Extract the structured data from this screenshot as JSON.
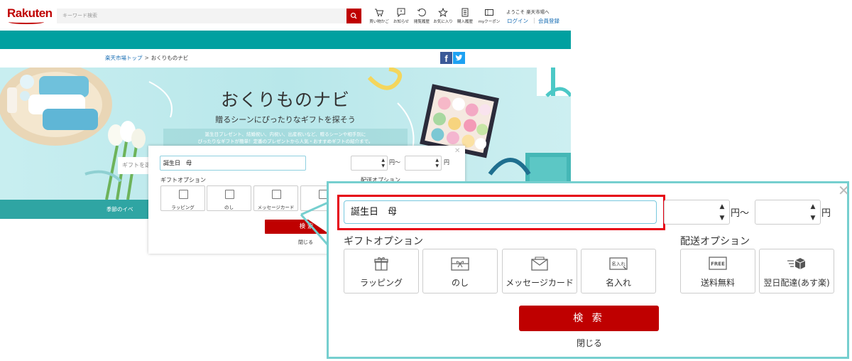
{
  "header": {
    "logo": "Rakuten",
    "search_placeholder": "キーワード検索",
    "icons": [
      {
        "label": "買い物かご",
        "icon": "cart-icon"
      },
      {
        "label": "お知らせ",
        "icon": "bell-icon"
      },
      {
        "label": "閲覧履歴",
        "icon": "history-icon"
      },
      {
        "label": "お気に入り",
        "icon": "star-icon"
      },
      {
        "label": "購入履歴",
        "icon": "receipt-icon"
      },
      {
        "label": "myクーポン",
        "icon": "coupon-icon"
      }
    ],
    "welcome": "ようこそ 楽天市場へ",
    "login": "ログイン",
    "separator": "|",
    "register": "会員登録"
  },
  "breadcrumb": {
    "home": "楽天市場トップ",
    "separator": ">",
    "current": "おくりものナビ"
  },
  "hero": {
    "title": "おくりものナビ",
    "subtitle": "贈るシーンにぴったりなギフトを探そう",
    "description_line1": "誕生日プレゼント、結婚祝い、内祝い、出産祝いなど、贈るシーンや相手別に",
    "description_line2": "ぴったりなギフトが簡単！定番のプレゼントから人気・おすすめギフトの紹介まで。",
    "search_placeholder": "ギフトを選"
  },
  "nav": {
    "season_label": "季節のイベ"
  },
  "popup": {
    "keyword": "誕生日　母",
    "yen_tilde": "円〜",
    "yen": "円",
    "gift_options_label": "ギフトオプション",
    "shipping_options_label": "配送オプション",
    "gift_options": [
      {
        "label": "ラッピング",
        "icon": "gift-box-icon"
      },
      {
        "label": "のし",
        "icon": "noshi-icon"
      },
      {
        "label": "メッセージカード",
        "icon": "envelope-icon"
      },
      {
        "label": "名入れ",
        "icon": "name-engrave-icon",
        "icon_text": "名入れ"
      }
    ],
    "shipping_options": [
      {
        "label": "送料無料",
        "icon": "free-shipping-icon",
        "icon_text": "FREE"
      },
      {
        "label": "翌日配達(あす楽)",
        "icon": "next-day-delivery-icon"
      }
    ],
    "search_button": "検 索",
    "close_text": "閉じる",
    "small_popup_ship_label": "配送オプション",
    "small_search_button": "検 索"
  },
  "colors": {
    "brand_red": "#bf0000",
    "teal": "#00a0a0",
    "highlight_red": "#e60012",
    "zoom_border": "#76cfcf"
  }
}
